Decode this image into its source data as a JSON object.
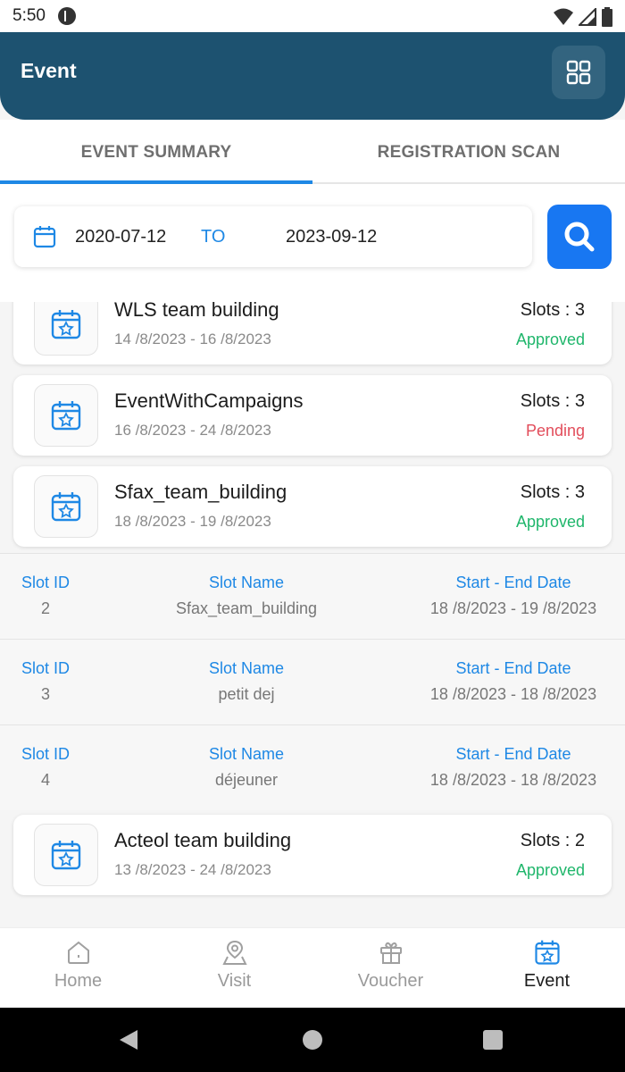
{
  "status": {
    "time": "5:50"
  },
  "header": {
    "title": "Event"
  },
  "tabs": [
    {
      "label": "EVENT SUMMARY",
      "active": true
    },
    {
      "label": "REGISTRATION SCAN",
      "active": false
    }
  ],
  "filter": {
    "from": "2020-07-12",
    "to_label": "TO",
    "to": "2023-09-12"
  },
  "events": [
    {
      "title": "WLS team building",
      "dates": "14 /8/2023 - 16 /8/2023",
      "slots": "Slots : 3",
      "status": "Approved"
    },
    {
      "title": "EventWithCampaigns",
      "dates": "16 /8/2023 - 24 /8/2023",
      "slots": "Slots : 3",
      "status": "Pending"
    },
    {
      "title": "Sfax_team_building",
      "dates": "18 /8/2023 - 19 /8/2023",
      "slots": "Slots : 3",
      "status": "Approved"
    },
    {
      "title": "Acteol team building",
      "dates": "13 /8/2023 - 24 /8/2023",
      "slots": "Slots : 2",
      "status": "Approved"
    }
  ],
  "slot_headers": {
    "id": "Slot ID",
    "name": "Slot Name",
    "dates": "Start - End Date"
  },
  "slots": [
    {
      "id": "2",
      "name": "Sfax_team_building",
      "dates": "18 /8/2023 - 19 /8/2023"
    },
    {
      "id": "3",
      "name": "petit dej",
      "dates": "18 /8/2023 - 18 /8/2023"
    },
    {
      "id": "4",
      "name": "déjeuner",
      "dates": "18 /8/2023 - 18 /8/2023"
    }
  ],
  "nav": [
    {
      "label": "Home",
      "icon": "home-icon"
    },
    {
      "label": "Visit",
      "icon": "map-pin-icon"
    },
    {
      "label": "Voucher",
      "icon": "gift-icon"
    },
    {
      "label": "Event",
      "icon": "calendar-star-icon",
      "active": true
    }
  ],
  "colors": {
    "header": "#1d5270",
    "accent": "#1e88e5",
    "approved": "#1fb66b",
    "pending": "#e24d5b"
  }
}
